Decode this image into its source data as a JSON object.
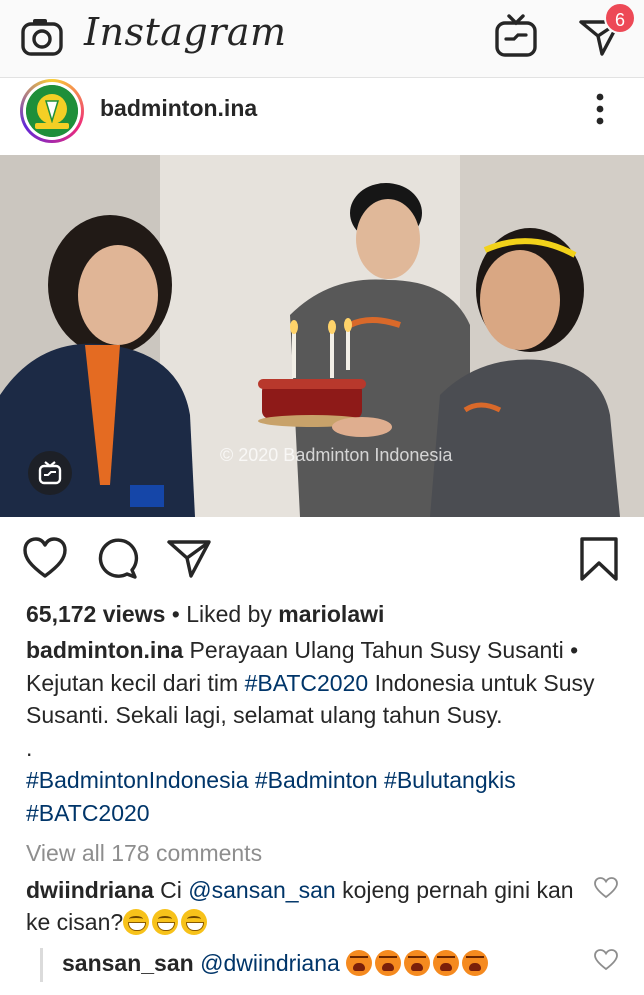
{
  "topbar": {
    "app_name": "Instagram",
    "direct_badge_count": "6",
    "icons": [
      "camera-icon",
      "igtv-icon",
      "direct-message-icon"
    ]
  },
  "post": {
    "username": "badminton.ina",
    "avatar_text": "PBSI",
    "media": {
      "watermark": "© 2020 Badminton Indonesia",
      "shirt_text": "-NIFG"
    },
    "views": "65,172 views",
    "liked_by_prefix": " • Liked by ",
    "liked_by_user": "mariolawi",
    "caption": {
      "user": "badminton.ina",
      "text_1": " Perayaan Ulang Tahun Susy Susanti • Kejutan kecil dari tim ",
      "tag_1": "#BATC2020",
      "text_2": " Indonesia untuk Susy Susanti. Sekali lagi, selamat ulang tahun Susy.",
      "dot": ".",
      "hashtags": [
        "#BadmintonIndonesia",
        "#Badminton",
        "#Bulutangkis",
        "#BATC2020"
      ]
    },
    "view_all_comments": "View all 178 comments",
    "comments": [
      {
        "user": "dwiindriana",
        "text_prefix": " Ci ",
        "mention": "@sansan_san",
        "text_suffix": " kojeng pernah gini kan ke cisan?",
        "emoji_count": 3
      }
    ],
    "reply": {
      "user": "sansan_san",
      "mention": "@dwiindriana",
      "emoji_count": 5
    }
  },
  "colors": {
    "hashtag": "#003569",
    "badge": "#ed4956",
    "muted": "#8e8e8e"
  }
}
